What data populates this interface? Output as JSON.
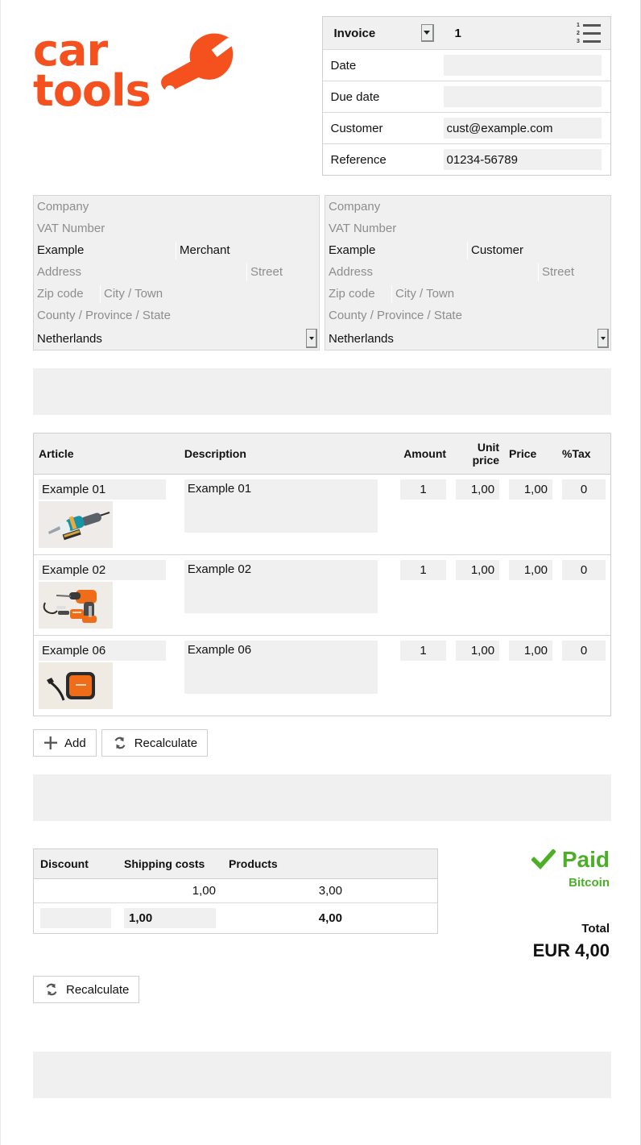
{
  "logo": {
    "line1": "car",
    "line2": "tools",
    "icon": "wrench-icon",
    "color": "#f4511e"
  },
  "invoice_header": {
    "doc_type": "Invoice",
    "doc_type_icon": "chevron-down-icon",
    "number": "1",
    "list_icon": "numbered-list-icon",
    "rows": [
      {
        "label": "Date",
        "value": ""
      },
      {
        "label": "Due date",
        "value": ""
      },
      {
        "label": "Customer",
        "value": "cust@example.com"
      },
      {
        "label": "Reference",
        "value": "01234-56789"
      }
    ]
  },
  "merchant": {
    "company_placeholder": "Company",
    "vat_placeholder": "VAT Number",
    "first_name": "Example",
    "last_name": "Merchant",
    "address_placeholder": "Address",
    "street_placeholder": "Street",
    "zip_placeholder": "Zip code",
    "city_placeholder": "City / Town",
    "county_placeholder": "County / Province / State",
    "country": "Netherlands",
    "country_icon": "chevron-down-icon"
  },
  "customer": {
    "company_placeholder": "Company",
    "vat_placeholder": "VAT Number",
    "first_name": "Example",
    "last_name": "Customer",
    "address_placeholder": "Address",
    "street_placeholder": "Street",
    "zip_placeholder": "Zip code",
    "city_placeholder": "City / Town",
    "county_placeholder": "County / Province / State",
    "country": "Netherlands",
    "country_icon": "chevron-down-icon"
  },
  "notes_top": {
    "value": "",
    "placeholder": ""
  },
  "notes_mid": {
    "value": "",
    "placeholder": ""
  },
  "notes_bottom": {
    "value": "",
    "placeholder": ""
  },
  "items_table": {
    "columns": [
      "Article",
      "Description",
      "Amount",
      "Unit price",
      "Price",
      "%Tax"
    ],
    "rows": [
      {
        "article": "Example 01",
        "description": "Example 01",
        "amount": "1",
        "unit_price": "1,00",
        "price": "1,00",
        "tax": "0",
        "thumb": "multi-tool-teal"
      },
      {
        "article": "Example 02",
        "description": "Example 02",
        "amount": "1",
        "unit_price": "1,00",
        "price": "1,00",
        "tax": "0",
        "thumb": "cordless-drill-orange"
      },
      {
        "article": "Example 06",
        "description": "Example 06",
        "amount": "1",
        "unit_price": "1,00",
        "price": "1,00",
        "tax": "0",
        "thumb": "orange-case-device"
      }
    ]
  },
  "item_buttons": {
    "add_label": "Add",
    "add_icon": "plus-icon",
    "recalculate_label": "Recalculate",
    "recalculate_icon": "refresh-icon"
  },
  "totals_table": {
    "columns": [
      "Discount",
      "Shipping costs",
      "Products"
    ],
    "row_readonly": {
      "discount": "",
      "shipping": "1,00",
      "products": "3,00"
    },
    "row_editable": {
      "discount": "",
      "shipping": "1,00",
      "products": "4,00"
    }
  },
  "totals_recalculate": {
    "label": "Recalculate",
    "icon": "refresh-icon"
  },
  "payment": {
    "status": "Paid",
    "status_icon": "check-icon",
    "status_color": "#4caf27",
    "method": "Bitcoin",
    "total_label": "Total",
    "total_amount": "EUR 4,00"
  }
}
